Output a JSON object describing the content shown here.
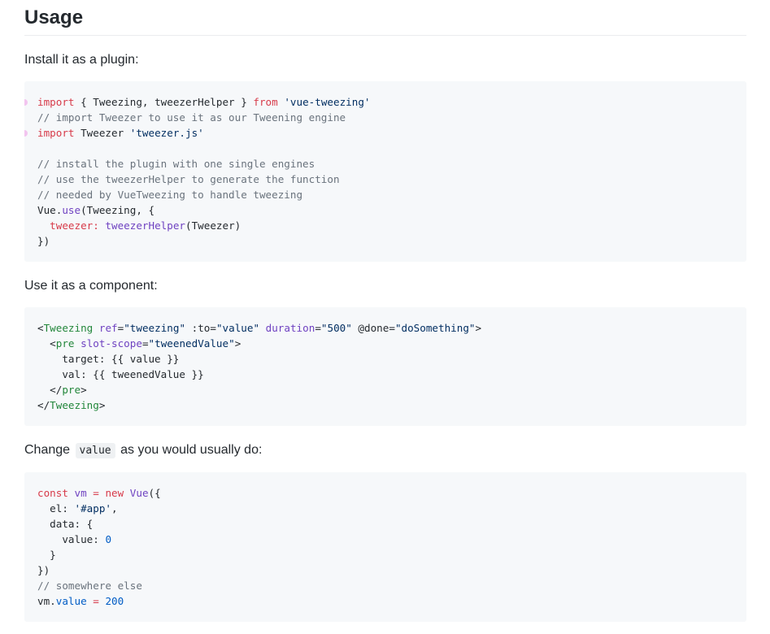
{
  "heading": "Usage",
  "paragraphs": {
    "install": "Install it as a plugin:",
    "component": "Use it as a component:",
    "change_before": "Change",
    "change_code": "value",
    "change_after": "as you would usually do:"
  },
  "code1": {
    "l1": {
      "kw1": "import",
      "mid": " { Tweezing, tweezerHelper } ",
      "kw2": "from",
      "sp": " ",
      "str": "'vue-tweezing'"
    },
    "l2": "// import Tweezer to use it as our Tweening engine",
    "l3": {
      "kw": "import",
      "mid": " Tweezer ",
      "str": "'tweezer.js'"
    },
    "l5": "// install the plugin with one single engines",
    "l6": "// use the tweezerHelper to generate the function",
    "l7": "// needed by VueTweezing to handle tweezing",
    "l8": {
      "a": "Vue.",
      "fn": "use",
      "b": "(Tweezing, {"
    },
    "l9": {
      "indent": "  ",
      "key": "tweezer",
      "colon": ": ",
      "fn": "tweezerHelper",
      "b": "(Tweezer)"
    },
    "l10": "})"
  },
  "code2": {
    "l1": {
      "lt": "<",
      "tag": "Tweezing",
      "sp1": " ",
      "a1": "ref",
      "eq1": "=",
      "v1": "\"tweezing\"",
      "sp2": " ",
      "a2": ":to",
      "eq2": "=",
      "v2": "\"value\"",
      "sp3": " ",
      "a3": "duration",
      "eq3": "=",
      "v3": "\"500\"",
      "sp4": " ",
      "a4": "@done",
      "eq4": "=",
      "v4": "\"doSomething\"",
      "gt": ">"
    },
    "l2": {
      "indent": "  ",
      "lt": "<",
      "tag": "pre",
      "sp": " ",
      "a": "slot-scope",
      "eq": "=",
      "v": "\"tweenedValue\"",
      "gt": ">"
    },
    "l3": "    target: {{ value }}",
    "l4": "    val: {{ tweenedValue }}",
    "l5": {
      "indent": "  ",
      "lt": "</",
      "tag": "pre",
      "gt": ">"
    },
    "l6": {
      "lt": "</",
      "tag": "Tweezing",
      "gt": ">"
    }
  },
  "code3": {
    "l1": {
      "kw1": "const",
      "sp1": " ",
      "var": "vm",
      "eq": " = ",
      "kw2": "new",
      "sp2": " ",
      "cls": "Vue",
      "b": "({"
    },
    "l2": {
      "indent": "  ",
      "key": "el",
      "colon": ": ",
      "str": "'#app'",
      "comma": ","
    },
    "l3": {
      "indent": "  ",
      "key": "data",
      "rest": ": {"
    },
    "l4": {
      "indent": "    ",
      "key": "value",
      "colon": ": ",
      "num": "0"
    },
    "l5": "  }",
    "l6": "})",
    "l7": "// somewhere else",
    "l8": {
      "a": "vm.",
      "prop": "value",
      "eq": " ",
      "op": "=",
      "sp": " ",
      "num": "200"
    }
  },
  "colors": {
    "keyword": "#d73a49",
    "string": "#032f62",
    "comment": "#6a737d",
    "function": "#6f42c1",
    "tag": "#22863a",
    "number": "#005cc5",
    "code_background": "#f6f8fa",
    "marker_dot": "#f2c4ef"
  }
}
